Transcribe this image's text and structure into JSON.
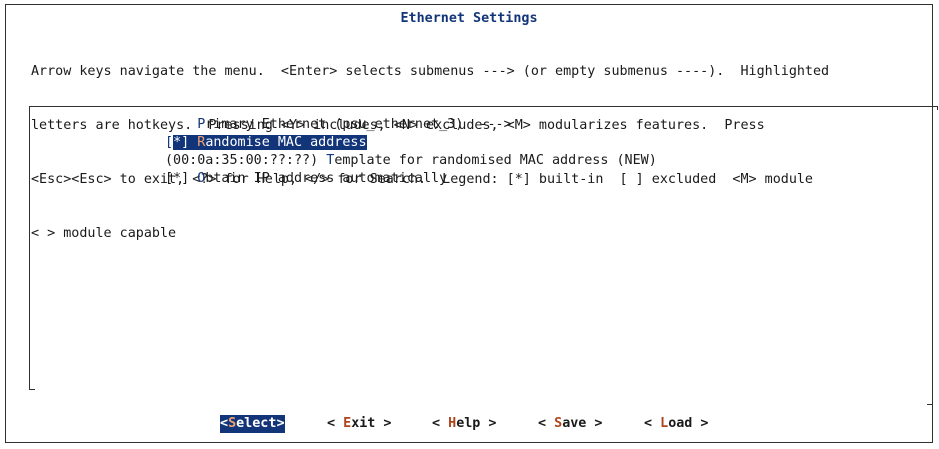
{
  "window": {
    "title": "Ethernet Settings"
  },
  "help": {
    "lines": [
      "Arrow keys navigate the menu.  <Enter> selects submenus ---> (or empty submenus ----).  Highlighted",
      "letters are hotkeys.  Pressing <Y> includes, <N> excludes, <M> modularizes features.  Press",
      "<Esc><Esc> to exit, <?> for Help, </> for Search.  Legend: [*] built-in  [ ] excluded  <M> module",
      "< > module capable"
    ]
  },
  "menu": {
    "items": [
      {
        "prefix": "    ",
        "hotkey": "P",
        "rest": "rimary Ethernet (psu_ethernet_3)  --->",
        "selected": false
      },
      {
        "prefix_open": "[",
        "prefix_mark": "*",
        "prefix_close": "] ",
        "hotkey": "R",
        "rest": "andomise MAC address",
        "selected": true
      },
      {
        "prefix": "(00:0a:35:00:??:??) ",
        "hotkey": "T",
        "rest": "emplate for randomised MAC address (NEW)",
        "selected": false
      },
      {
        "prefix": "[*] ",
        "hotkey": "O",
        "rest": "btain IP address automatically",
        "selected": false
      }
    ]
  },
  "buttons": [
    {
      "open": "<",
      "hotkey": "S",
      "rest": "elect",
      "close": ">",
      "active": true
    },
    {
      "open": "< ",
      "hotkey": "E",
      "rest": "xit",
      "close": " >",
      "active": false
    },
    {
      "open": "< ",
      "hotkey": "H",
      "rest": "elp",
      "close": " >",
      "active": false
    },
    {
      "open": "< ",
      "hotkey": "S",
      "rest": "ave",
      "close": " >",
      "active": false
    },
    {
      "open": "< ",
      "hotkey": "L",
      "rest": "oad",
      "close": " >",
      "active": false
    }
  ],
  "colors": {
    "accent": "#12357a",
    "hotkey": "#b0451c",
    "background": "#ffffff"
  }
}
